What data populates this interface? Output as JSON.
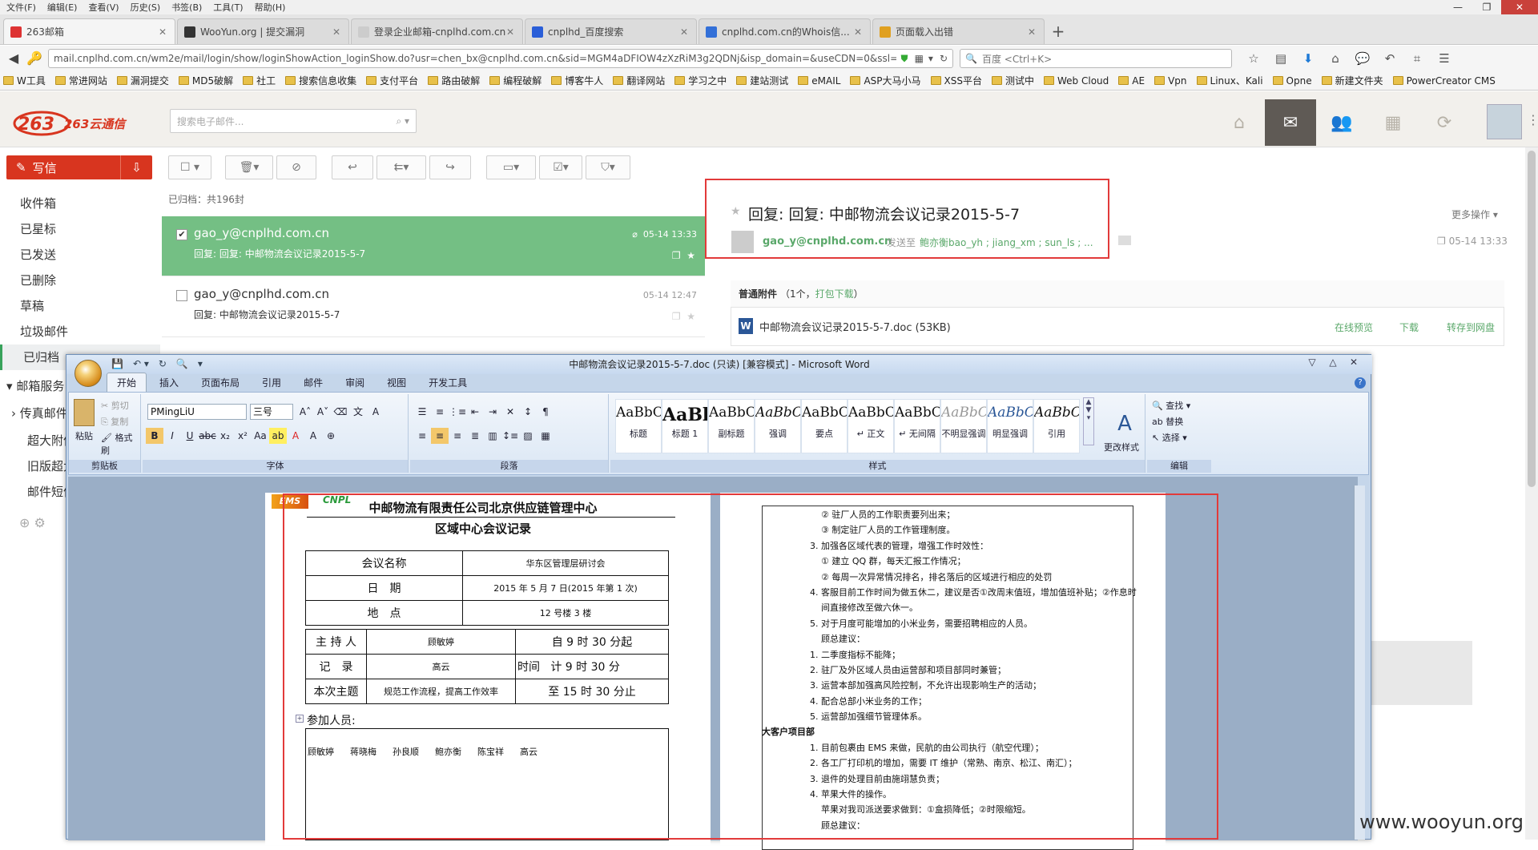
{
  "menubar": [
    "文件(F)",
    "编辑(E)",
    "查看(V)",
    "历史(S)",
    "书签(B)",
    "工具(T)",
    "帮助(H)"
  ],
  "tabs": [
    {
      "label": "263邮箱",
      "color": "#d33"
    },
    {
      "label": "WooYun.org | 提交漏洞",
      "color": "#333"
    },
    {
      "label": "登录企业邮箱-cnplhd.com.cn...",
      "color": "#ccc"
    },
    {
      "label": "cnplhd_百度搜索",
      "color": "#2a5ed8"
    },
    {
      "label": "cnplhd.com.cn的Whois信...",
      "color": "#3370d8"
    },
    {
      "label": "页面载入出错",
      "color": "#e0a020"
    }
  ],
  "url": "mail.cnplhd.com.cn/wm2e/mail/login/show/loginShowAction_loginShow.do?usr=chen_bx@cnplhd.com.cn&sid=MGM4aDFIOW4zXzRiM3g2QDNj&isp_domain=&useCDN=0&ssl=false#",
  "search_placeholder": "百度 <Ctrl+K>",
  "bookmarks": [
    "W工具",
    "常进网站",
    "漏洞提交",
    "MD5破解",
    "社工",
    "搜索信息收集",
    "支付平台",
    "路由破解",
    "编程破解",
    "博客牛人",
    "翻译网站",
    "学习之中",
    "建站测试",
    "eMAIL",
    "ASP大马小马",
    "XSS平台",
    "测试中",
    "Web Cloud",
    "AE",
    "Vpn",
    "Linux、Kali",
    "Opne",
    "新建文件夹",
    "PowerCreator CMS"
  ],
  "mail": {
    "logo_text": "263云通信",
    "search_placeholder": "搜索电子邮件...",
    "compose": "写信",
    "folders": [
      "收件箱",
      "已星标",
      "已发送",
      "已删除",
      "草稿",
      "垃圾邮件",
      "已归档"
    ],
    "services_header": "邮箱服务",
    "services": [
      "传真邮件",
      "超大附件",
      "旧版超大",
      "邮件短信"
    ],
    "count_label": "已归档：共196封",
    "messages": [
      {
        "from": "gao_y@cnplhd.com.cn",
        "subject": "回复: 回复: 中邮物流会议记录2015-5-7",
        "date": "05-14 13:33"
      },
      {
        "from": "gao_y@cnplhd.com.cn",
        "subject": "回复: 中邮物流会议记录2015-5-7",
        "date": "05-14 12:47"
      }
    ],
    "reading": {
      "title": "回复: 回复: 中邮物流会议记录2015-5-7",
      "from": "gao_y@cnplhd.com.cn",
      "sent_to_label": "发送至",
      "to": "鲍亦衡bao_yh ; jiang_xm ; sun_ls ; ...",
      "date": "05-14 13:33",
      "more": "更多操作 ▾",
      "att_header": "普通附件",
      "att_count": "（1个，",
      "att_download": "打包下载",
      "att_close": "）",
      "att_file": "中邮物流会议记录2015-5-7.doc (53KB)",
      "att_preview": "在线预览",
      "att_dl": "下载",
      "att_save": "转存到网盘"
    }
  },
  "word": {
    "title": "中邮物流会议记录2015-5-7.doc (只读) [兼容模式] - Microsoft Word",
    "tabs": [
      "开始",
      "插入",
      "页面布局",
      "引用",
      "邮件",
      "审阅",
      "视图",
      "开发工具"
    ],
    "clipboard": {
      "paste": "粘贴",
      "cut": "剪切",
      "copy": "复制",
      "painter": "格式刷",
      "label": "剪贴板"
    },
    "font": {
      "name": "PMingLiU",
      "size": "三号",
      "label": "字体"
    },
    "paragraph_label": "段落",
    "styles_label": "样式",
    "styles": [
      {
        "sample": "AaBbC",
        "name": "标题"
      },
      {
        "sample": "AaBl",
        "name": "标题 1"
      },
      {
        "sample": "AaBbC",
        "name": "副标题"
      },
      {
        "sample": "AaBbCcL",
        "name": "强调"
      },
      {
        "sample": "AaBbCcl",
        "name": "要点"
      },
      {
        "sample": "AaBbCcI",
        "name": "↵ 正文"
      },
      {
        "sample": "AaBbCcI",
        "name": "↵ 无间隔"
      },
      {
        "sample": "AaBbCcL",
        "name": "不明显强调"
      },
      {
        "sample": "AaBbCc",
        "name": "明显强调"
      },
      {
        "sample": "AaBbCcL",
        "name": "引用"
      }
    ],
    "change_styles": "更改样式",
    "editing": {
      "find": "查找",
      "replace": "替换",
      "select": "选择",
      "label": "编辑"
    },
    "page1": {
      "logo_ems": "EMS",
      "logo_cnpl": "CNPL",
      "title1": "中邮物流有限责任公司北京供应链管理中心",
      "title2": "区域中心会议记录",
      "rows": [
        [
          "会议名称",
          "华东区管理层研讨会"
        ],
        [
          "日　期",
          "2015 年 5 月 7 日(2015 年第 1 次)"
        ],
        [
          "地　点",
          "12 号楼 3 楼"
        ]
      ],
      "host_label": "主 持 人",
      "host": "顾敏婷",
      "start": "自 9 时 30 分起",
      "rec_label": "记　录",
      "rec": "高云",
      "time_label": "时间",
      "time_mid": "计 9 时 30 分",
      "topic_label": "本次主题",
      "topic": "规范工作流程，提高工作效率",
      "end": "至 15 时 30 分止",
      "attend_label": "参加人员:",
      "attendees": [
        "顾敏婷",
        "蒋晓梅",
        "孙良顺",
        "鲍亦衡",
        "陈宝祥",
        "高云"
      ]
    },
    "page2": [
      "② 驻厂人员的工作职责要列出来；",
      "③ 制定驻厂人员的工作管理制度。",
      "3.  加强各区域代表的管理，增强工作时效性：",
      "① 建立 QQ 群，每天汇报工作情况；",
      "② 每周一次异常情况排名，排名落后的区域进行相应的处罚",
      "4.  客服目前工作时间为做五休二，建议是否①改周末值班，增加值班补贴；②作息时",
      "间直接修改至做六休一。",
      "5.  对于月度可能增加的小米业务，需要招聘相应的人员。",
      "顾总建议：",
      "1.  二季度指标不能降；",
      "2.  驻厂及外区域人员由运营部和项目部同时兼管；",
      "3.  运营本部加强高风险控制，不允许出现影响生产的活动；",
      "4.  配合总部小米业务的工作；",
      "5.  运营部加强细节管理体系。",
      "大客户项目部",
      "1.  目前包裹由 EMS 来做，民航的由公司执行（航空代理）；",
      "2.  各工厂打印机的增加，需要 IT 维护（常熟、南京、松江、南汇）；",
      "3.  退件的处理目前由施翊慧负责；",
      "4.  苹果大件的操作。",
      "苹果对我司派送要求做到：①盒损降低；②时限缩短。",
      "顾总建议："
    ]
  },
  "watermark": "www.wooyun.org"
}
